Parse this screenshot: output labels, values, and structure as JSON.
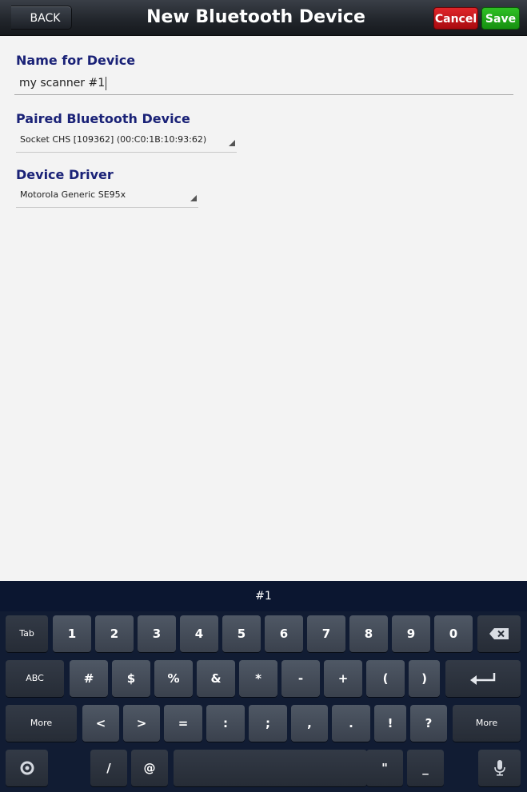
{
  "header": {
    "back_label": "BACK",
    "title": "New Bluetooth Device",
    "cancel_label": "Cancel",
    "save_label": "Save",
    "cancel_color": "#c4161b",
    "save_color": "#22a818"
  },
  "form": {
    "name_label": "Name for Device",
    "name_value": "my scanner #1",
    "paired_label": "Paired Bluetooth Device",
    "paired_value": "Socket CHS [109362] (00:C0:1B:10:93:62)",
    "driver_label": "Device Driver",
    "driver_value": "Motorola Generic SE95x",
    "label_color": "#1a2277"
  },
  "keyboard": {
    "suggestion": "#1",
    "row1": [
      "Tab",
      "1",
      "2",
      "3",
      "4",
      "5",
      "6",
      "7",
      "8",
      "9",
      "0",
      "backspace"
    ],
    "row2": [
      "ABC",
      "#",
      "$",
      "%",
      "&",
      "*",
      "-",
      "+",
      "(",
      ")",
      "enter"
    ],
    "row3": [
      "More",
      "<",
      ">",
      "=",
      ":",
      ";",
      ",",
      ".",
      "!",
      "?",
      "More"
    ],
    "row4": [
      "settings",
      "/",
      "@",
      "space",
      "\"",
      "_",
      "mic"
    ]
  }
}
